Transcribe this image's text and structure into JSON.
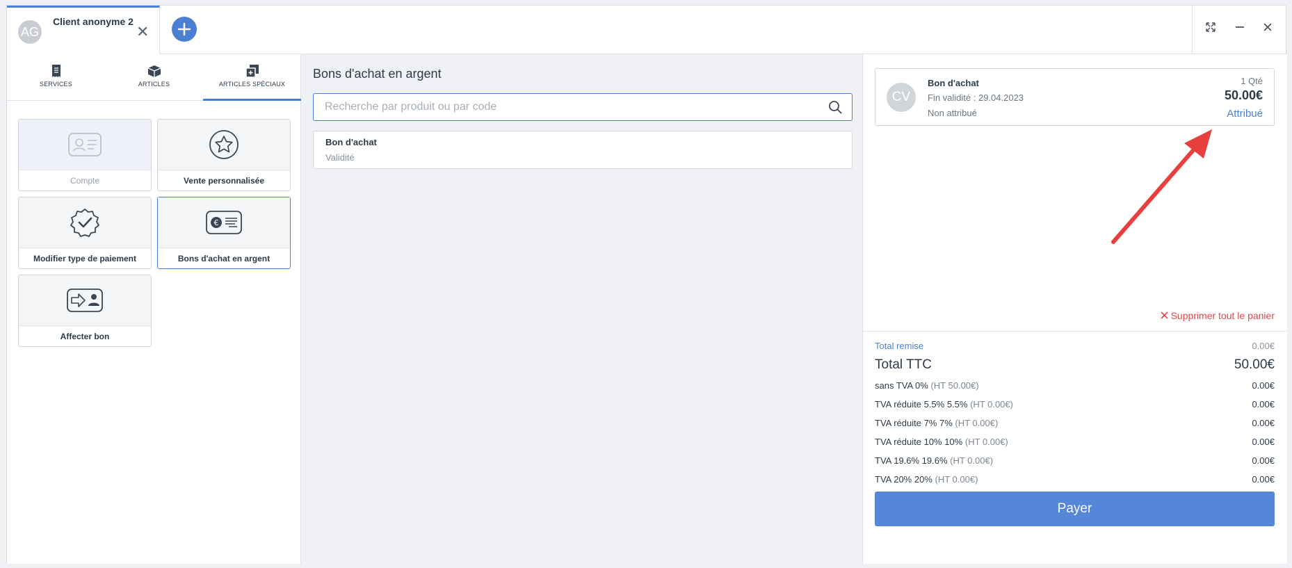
{
  "header": {
    "client_avatar": "AG",
    "client_name": "Client anonyme 2",
    "tab_close_icon": "close-icon",
    "add_icon": "plus-icon",
    "window_controls": [
      "expand-icon",
      "minimize-icon",
      "close-icon"
    ]
  },
  "categories": {
    "tabs": [
      {
        "label": "SERVICES",
        "icon": "receipt-icon"
      },
      {
        "label": "ARTICLES",
        "icon": "box-icon"
      },
      {
        "label": "ARTICLES SPÉCIAUX",
        "icon": "special-items-icon"
      }
    ],
    "active": "ARTICLES SPÉCIAUX"
  },
  "tiles": [
    {
      "label": "Compte",
      "icon": "id-card-icon",
      "state": "disabled"
    },
    {
      "label": "Vente personnalisée",
      "icon": "star-icon",
      "state": "normal"
    },
    {
      "label": "Modifier type de paiement",
      "icon": "badge-check-icon",
      "state": "normal"
    },
    {
      "label": "Bons d'achat en argent",
      "icon": "voucher-euro-icon",
      "state": "selected"
    },
    {
      "label": "Affecter bon",
      "icon": "assign-voucher-icon",
      "state": "normal"
    }
  ],
  "middle": {
    "title": "Bons d'achat en argent",
    "search_placeholder": "Recherche par produit ou par code",
    "search_value": "",
    "products": [
      {
        "name": "Bon d'achat",
        "sub": "Validité"
      }
    ]
  },
  "cart": {
    "item": {
      "avatar": "CV",
      "name": "Bon d'achat",
      "validity": "Fin validité : 29.04.2023",
      "assignment": "Non attribué",
      "qty": "1 Qté",
      "price": "50.00€",
      "action": "Attribué"
    },
    "annotation_color": "#e8403f",
    "clear_label": "Supprimer tout le panier"
  },
  "totals": {
    "remise_label": "Total remise",
    "remise_value": "0.00€",
    "ttc_label": "Total TTC",
    "ttc_value": "50.00€",
    "tax_rows": [
      {
        "label": "sans TVA 0%",
        "ht": "(HT 50.00€)",
        "value": "0.00€"
      },
      {
        "label": "TVA réduite 5.5% 5.5%",
        "ht": "(HT 0.00€)",
        "value": "0.00€"
      },
      {
        "label": "TVA réduite 7% 7%",
        "ht": "(HT 0.00€)",
        "value": "0.00€"
      },
      {
        "label": "TVA réduite 10% 10%",
        "ht": "(HT 0.00€)",
        "value": "0.00€"
      },
      {
        "label": "TVA 19.6% 19.6%",
        "ht": "(HT 0.00€)",
        "value": "0.00€"
      },
      {
        "label": "TVA 20% 20%",
        "ht": "(HT 0.00€)",
        "value": "0.00€"
      }
    ],
    "pay_label": "Payer"
  },
  "colors": {
    "accent": "#4a7fd4",
    "danger": "#e04848"
  }
}
